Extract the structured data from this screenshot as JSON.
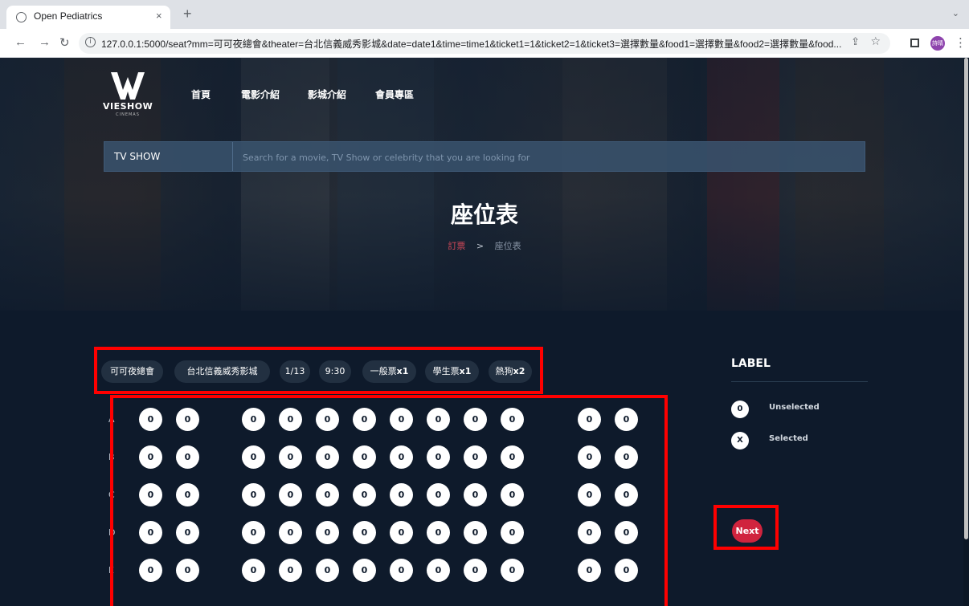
{
  "browser": {
    "tab_title": "Open Pediatrics",
    "tab_close": "×",
    "new_tab": "+",
    "url": "127.0.0.1:5000/seat?mm=可可夜總會&theater=台北信義威秀影城&date=date1&time=time1&ticket1=1&ticket2=1&ticket3=選擇數量&food1=選擇數量&food2=選擇數量&food...",
    "profile_initials": "詩晴"
  },
  "site": {
    "brand": "VIESHOW",
    "brand_sub": "CINEMAS",
    "nav": [
      "首頁",
      "電影介紹",
      "影城介紹",
      "會員專區"
    ]
  },
  "search": {
    "category": "TV SHOW",
    "placeholder": "Search for a movie, TV Show or celebrity that you are looking for"
  },
  "hero": {
    "title": "座位表",
    "breadcrumb": {
      "parent": "訂票",
      "separator": ">",
      "current": "座位表"
    }
  },
  "booking": {
    "tags": [
      {
        "text": "可可夜總會",
        "mult": ""
      },
      {
        "text": "台北信義威秀影城",
        "mult": ""
      },
      {
        "text": "1/13",
        "mult": ""
      },
      {
        "text": "9:30",
        "mult": ""
      },
      {
        "text": "一般票",
        "mult": "x1"
      },
      {
        "text": "學生票",
        "mult": "x1"
      },
      {
        "text": "熱狗",
        "mult": "x2"
      }
    ],
    "seat_rows": [
      "A",
      "B",
      "C",
      "D",
      "E"
    ],
    "seat_groups": [
      2,
      8,
      2
    ],
    "unselected_symbol": "0",
    "selected_symbol": "X"
  },
  "legend": {
    "title": "LABEL",
    "items": [
      {
        "symbol": "0",
        "label": "Unselected"
      },
      {
        "symbol": "X",
        "label": "Selected"
      }
    ]
  },
  "actions": {
    "next_label": "Next"
  },
  "colors": {
    "page_bg": "#0e1a2b",
    "tag_bg": "#223041",
    "accent": "#d0243e",
    "highlight_box": "#ff0000"
  }
}
